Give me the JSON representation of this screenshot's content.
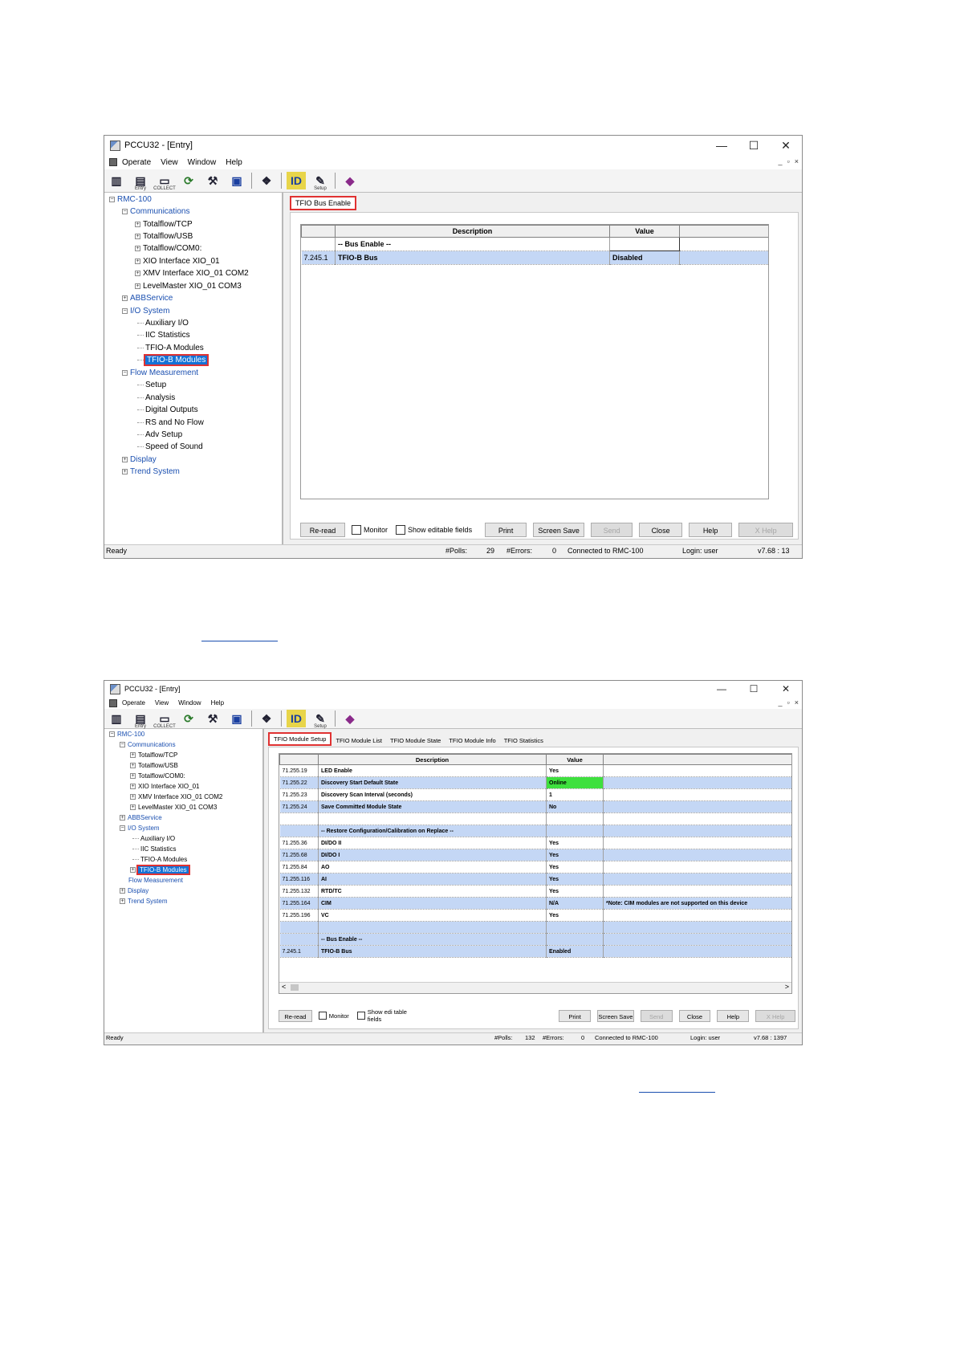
{
  "window1": {
    "title": "PCCU32 - [Entry]",
    "title_controls": [
      "—",
      "☐",
      "✕"
    ],
    "menu": [
      "Operate",
      "View",
      "Window",
      "Help"
    ],
    "mdi_controls": [
      "_",
      "▫",
      "×"
    ],
    "toolbar_labels": {
      "entry": "Entry",
      "collect": "COLLECT",
      "setup": "Setup",
      "io": "IO"
    },
    "tree": {
      "root": "RMC-100",
      "communications": "Communications",
      "totalflow_tcp": "Totalflow/TCP",
      "totalflow_usb": "Totalflow/USB",
      "totalflow_com0": "Totalflow/COM0:",
      "xio_interface": "XIO Interface XIO_01",
      "xmv_interface": "XMV Interface XIO_01 COM2",
      "levelmaster": "LevelMaster XIO_01 COM3",
      "abbservice": "ABBService",
      "io_system": "I/O System",
      "auxiliary_io": "Auxiliary I/O",
      "iic_statistics": "IIC Statistics",
      "tfio_a": "TFIO-A Modules",
      "tfio_b": "TFIO-B Modules",
      "flow_measurement": "Flow Measurement",
      "setup": "Setup",
      "analysis": "Analysis",
      "digital_outputs": "Digital Outputs",
      "rs_no_flow": "RS and No Flow",
      "adv_setup": "Adv Setup",
      "speed_of_sound": "Speed of Sound",
      "display": "Display",
      "trend_system": "Trend System"
    },
    "tab": "TFIO Bus Enable",
    "columns": {
      "description": "Description",
      "value": "Value"
    },
    "rows": [
      {
        "id": "",
        "description": "-- Bus Enable --",
        "value": ""
      },
      {
        "id": "7.245.1",
        "description": "TFIO-B Bus",
        "value": "Disabled"
      }
    ],
    "buttons": {
      "reread": "Re-read",
      "monitor": "Monitor",
      "show_editable": "Show editable fields",
      "print": "Print",
      "screen_save": "Screen Save",
      "send": "Send",
      "close": "Close",
      "help": "Help",
      "xhelp": "X Help"
    },
    "status": {
      "ready": "Ready",
      "polls_label": "#Polls:",
      "polls": "29",
      "errors_label": "#Errors:",
      "errors": "0",
      "connected": "Connected to RMC-100",
      "login": "Login: user",
      "version": "v7.68 : 13"
    }
  },
  "window2": {
    "title": "PCCU32 - [Entry]",
    "title_controls": [
      "—",
      "☐",
      "✕"
    ],
    "menu": [
      "Operate",
      "View",
      "Window",
      "Help"
    ],
    "mdi_controls": [
      "_",
      "▫",
      "×"
    ],
    "toolbar_labels": {
      "entry": "Entry",
      "collect": "COLLECT",
      "setup": "Setup",
      "io": "IO"
    },
    "tree": {
      "root": "RMC-100",
      "communications": "Communications",
      "totalflow_tcp": "Totalflow/TCP",
      "totalflow_usb": "Totalflow/USB",
      "totalflow_com0": "Totalflow/COM0:",
      "xio_interface": "XIO Interface XIO_01",
      "xmv_interface": "XMV Interface XIO_01 COM2",
      "levelmaster": "LevelMaster XIO_01 COM3",
      "abbservice": "ABBService",
      "io_system": "I/O System",
      "auxiliary_io": "Auxiliary I/O",
      "iic_statistics": "IIC Statistics",
      "tfio_a": "TFIO-A Modules",
      "tfio_b": "TFIO-B Modules",
      "flow_measurement": "Flow Measurement",
      "display": "Display",
      "trend_system": "Trend System"
    },
    "tabs": [
      "TFIO Module Setup",
      "TFIO Module List",
      "TFIO Module State",
      "TFIO Module Info",
      "TFIO Statistics"
    ],
    "columns": {
      "description": "Description",
      "value": "Value"
    },
    "rows": [
      {
        "id": "71.255.19",
        "description": "LED Enable",
        "value": "Yes",
        "note": ""
      },
      {
        "id": "71.255.22",
        "description": "Discovery Start Default State",
        "value": "Online",
        "note": ""
      },
      {
        "id": "71.255.23",
        "description": "Discovery Scan Interval (seconds)",
        "value": "1",
        "note": ""
      },
      {
        "id": "71.255.24",
        "description": "Save Committed Module State",
        "value": "No",
        "note": ""
      },
      {
        "id": "",
        "description": "",
        "value": "",
        "note": ""
      },
      {
        "id": "",
        "description": "-- Restore Configuration/Calibration on Replace --",
        "value": "",
        "note": ""
      },
      {
        "id": "71.255.36",
        "description": "DI/DO II",
        "value": "Yes",
        "note": ""
      },
      {
        "id": "71.255.68",
        "description": "DI/DO I",
        "value": "Yes",
        "note": ""
      },
      {
        "id": "71.255.84",
        "description": "AO",
        "value": "Yes",
        "note": ""
      },
      {
        "id": "71.255.116",
        "description": "AI",
        "value": "Yes",
        "note": ""
      },
      {
        "id": "71.255.132",
        "description": "RTD/TC",
        "value": "Yes",
        "note": ""
      },
      {
        "id": "71.255.164",
        "description": "CIM",
        "value": "N/A",
        "note": "*Note: CIM modules are not supported on this device"
      },
      {
        "id": "71.255.196",
        "description": "VC",
        "value": "Yes",
        "note": ""
      },
      {
        "id": "",
        "description": "",
        "value": "",
        "note": ""
      },
      {
        "id": "",
        "description": "-- Bus Enable --",
        "value": "",
        "note": ""
      },
      {
        "id": "7.245.1",
        "description": "TFIO-B Bus",
        "value": "Enabled",
        "note": ""
      }
    ],
    "scroll": {
      "left": "<",
      "right": ">"
    },
    "buttons": {
      "reread": "Re-read",
      "monitor": "Monitor",
      "show_editable": "Show edi table fields",
      "print": "Print",
      "screen_save": "Screen Save",
      "send": "Send",
      "close": "Close",
      "help": "Help",
      "xhelp": "X Help"
    },
    "status": {
      "ready": "Ready",
      "polls_label": "#Polls:",
      "polls": "132",
      "errors_label": "#Errors:",
      "errors": "0",
      "connected": "Connected to RMC-100",
      "login": "Login: user",
      "version": "v7.68 : 1397"
    }
  },
  "colors": {
    "selection": "#1572d6",
    "highlight_red": "#e03232",
    "row_highlight": "#c4d7f5",
    "online_green": "#3ee03e",
    "tree_blue": "#1a4fb0"
  }
}
